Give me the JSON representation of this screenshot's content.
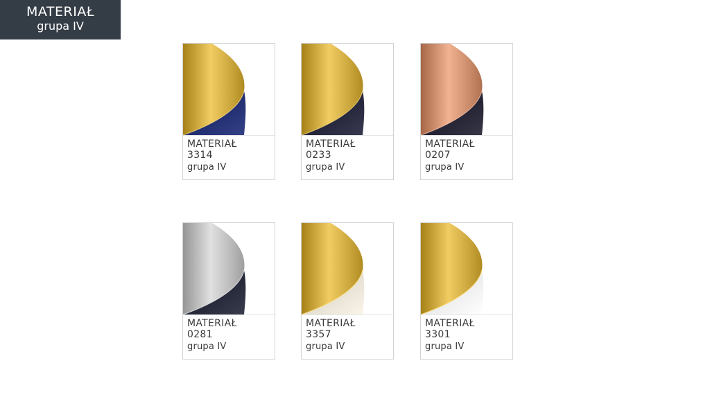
{
  "header": {
    "title": "MATERIAŁ",
    "subtitle": "grupa IV"
  },
  "materials": [
    {
      "label": "MATERIAŁ",
      "code": "3314",
      "group": "grupa IV",
      "inner_color": "#c9a43b",
      "outer_color": "#243074"
    },
    {
      "label": "MATERIAŁ",
      "code": "0233",
      "group": "grupa IV",
      "inner_color": "#c9a43b",
      "outer_color": "#27273d"
    },
    {
      "label": "MATERIAŁ",
      "code": "0207",
      "group": "grupa IV",
      "inner_color": "#c98a6a",
      "outer_color": "#252536"
    },
    {
      "label": "MATERIAŁ",
      "code": "0281",
      "group": "grupa IV",
      "inner_color": "#b8b8b8",
      "outer_color": "#262a3a"
    },
    {
      "label": "MATERIAŁ",
      "code": "3357",
      "group": "grupa IV",
      "inner_color": "#c9a43b",
      "outer_color": "#e8e3d6"
    },
    {
      "label": "MATERIAŁ",
      "code": "3301",
      "group": "grupa IV",
      "inner_color": "#c9a43b",
      "outer_color": "#efefef"
    }
  ]
}
